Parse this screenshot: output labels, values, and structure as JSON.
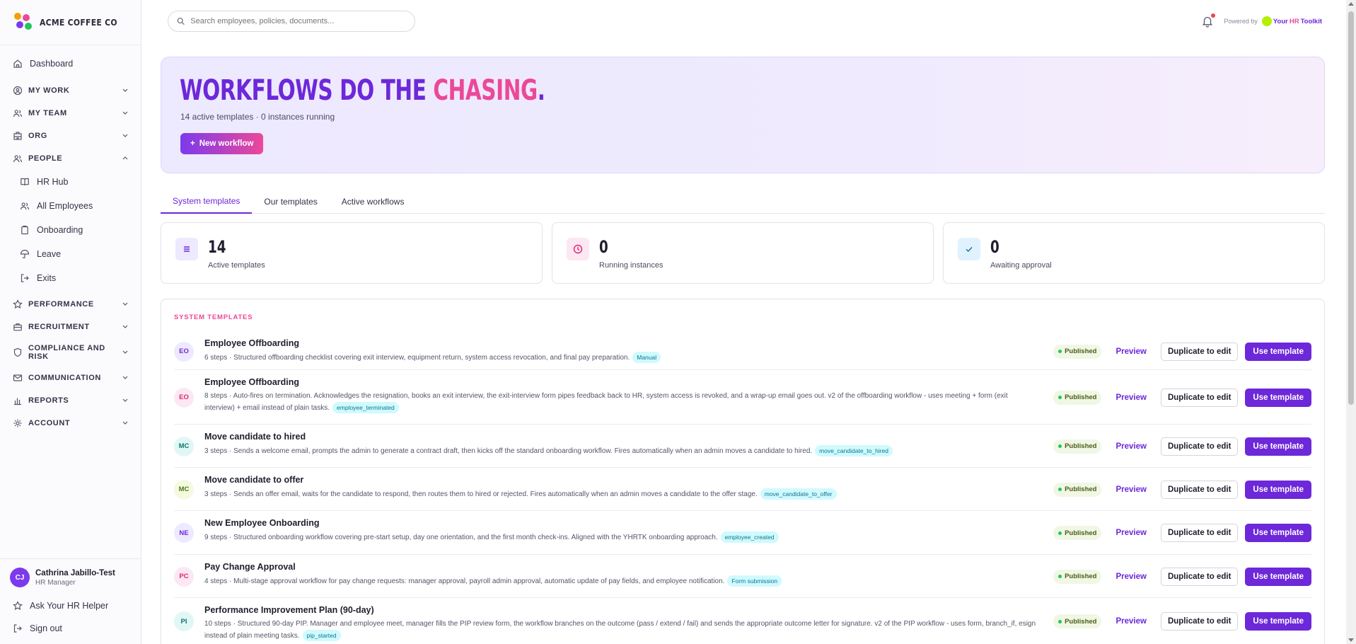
{
  "brand": {
    "name": "ACME COFFEE CO"
  },
  "sidebar": {
    "dashboard": "Dashboard",
    "sections": [
      {
        "label": "MY WORK",
        "icon": "user-circle-icon",
        "expanded": false
      },
      {
        "label": "MY TEAM",
        "icon": "users-icon",
        "expanded": false
      },
      {
        "label": "ORG",
        "icon": "building-icon",
        "expanded": false
      },
      {
        "label": "PEOPLE",
        "icon": "users-icon",
        "expanded": true
      },
      {
        "label": "PERFORMANCE",
        "icon": "star-icon",
        "expanded": false
      },
      {
        "label": "RECRUITMENT",
        "icon": "briefcase-icon",
        "expanded": false
      },
      {
        "label": "COMPLIANCE AND RISK",
        "icon": "shield-icon",
        "expanded": false
      },
      {
        "label": "COMMUNICATION",
        "icon": "mail-icon",
        "expanded": false
      },
      {
        "label": "REPORTS",
        "icon": "bar-chart-icon",
        "expanded": false
      },
      {
        "label": "ACCOUNT",
        "icon": "gear-icon",
        "expanded": false
      }
    ],
    "people_items": [
      {
        "label": "HR Hub",
        "icon": "book-icon"
      },
      {
        "label": "All Employees",
        "icon": "users-icon"
      },
      {
        "label": "Onboarding",
        "icon": "clipboard-icon"
      },
      {
        "label": "Leave",
        "icon": "umbrella-icon"
      },
      {
        "label": "Exits",
        "icon": "exit-icon"
      }
    ],
    "user": {
      "initials": "CJ",
      "name": "Cathrina Jabillo-Test",
      "role": "HR Manager"
    },
    "ask_helper": "Ask Your HR Helper",
    "sign_out": "Sign out"
  },
  "topbar": {
    "search_placeholder": "Search employees, policies, documents...",
    "powered_by": "Powered by",
    "toolkit_prefix": "Your",
    "toolkit_hr": "HR",
    "toolkit_suffix": "Toolkit"
  },
  "hero": {
    "title_part1": "WORKFLOWS DO THE ",
    "title_part2": "CHASING",
    "title_part3": ".",
    "subtitle": "14 active templates · 0 instances running",
    "new_button": "New workflow"
  },
  "tabs": [
    {
      "label": "System templates",
      "active": true
    },
    {
      "label": "Our templates",
      "active": false
    },
    {
      "label": "Active workflows",
      "active": false
    }
  ],
  "stats": [
    {
      "value": "14",
      "label": "Active templates",
      "icon": "list-icon",
      "color": "#ede9fe",
      "icon_color": "#6d28d9"
    },
    {
      "value": "0",
      "label": "Running instances",
      "icon": "clock-icon",
      "color": "#fce7f3",
      "icon_color": "#db2777"
    },
    {
      "value": "0",
      "label": "Awaiting approval",
      "icon": "check-icon",
      "color": "#e0f2fe",
      "icon_color": "#0e7490"
    }
  ],
  "templates_panel": {
    "heading": "SYSTEM TEMPLATES",
    "actions": {
      "status": "Published",
      "preview": "Preview",
      "duplicate": "Duplicate to edit",
      "use": "Use template"
    },
    "rows": [
      {
        "initials": "EO",
        "title": "Employee Offboarding",
        "desc": "6 steps · Structured offboarding checklist covering exit interview, equipment return, system access revocation, and final pay preparation.",
        "tag": "Manual",
        "avatar_bg": "#ede9fe",
        "avatar_fg": "#6d28d9"
      },
      {
        "initials": "EO",
        "title": "Employee Offboarding",
        "desc": "8 steps · Auto-fires on termination. Acknowledges the resignation, books an exit interview, the exit-interview form pipes feedback back to HR, system access is revoked, and a wrap-up email goes out. v2 of the offboarding workflow - uses meeting + form (exit interview) + email instead of plain tasks.",
        "tag": "employee_terminated",
        "avatar_bg": "#fce7f3",
        "avatar_fg": "#db2777"
      },
      {
        "initials": "MC",
        "title": "Move candidate to hired",
        "desc": "3 steps · Sends a welcome email, prompts the admin to generate a contract draft, then kicks off the standard onboarding workflow. Fires automatically when an admin moves a candidate to hired.",
        "tag": "move_candidate_to_hired",
        "avatar_bg": "#e0f7f5",
        "avatar_fg": "#0f766e"
      },
      {
        "initials": "MC",
        "title": "Move candidate to offer",
        "desc": "3 steps · Sends an offer email, waits for the candidate to respond, then routes them to hired or rejected. Fires automatically when an admin moves a candidate to the offer stage.",
        "tag": "move_candidate_to_offer",
        "avatar_bg": "#f4f9e0",
        "avatar_fg": "#4d7c0f"
      },
      {
        "initials": "NE",
        "title": "New Employee Onboarding",
        "desc": "9 steps · Structured onboarding workflow covering pre-start setup, day one orientation, and the first month check-ins. Aligned with the YHRTK onboarding approach.",
        "tag": "employee_created",
        "avatar_bg": "#ede9fe",
        "avatar_fg": "#6d28d9"
      },
      {
        "initials": "PC",
        "title": "Pay Change Approval",
        "desc": "4 steps · Multi-stage approval workflow for pay change requests: manager approval, payroll admin approval, automatic update of pay fields, and employee notification.",
        "tag": "Form submission",
        "avatar_bg": "#fce7f3",
        "avatar_fg": "#db2777"
      },
      {
        "initials": "PI",
        "title": "Performance Improvement Plan (90-day)",
        "desc": "10 steps · Structured 90-day PIP. Manager and employee meet, manager fills the PIP review form, the workflow branches on the outcome (pass / extend / fail) and sends the appropriate outcome letter for signature. v2 of the PIP workflow - uses form, branch_if, esign instead of plain meeting tasks.",
        "tag": "pip_started",
        "avatar_bg": "#e0f7f5",
        "avatar_fg": "#0f766e"
      }
    ]
  }
}
